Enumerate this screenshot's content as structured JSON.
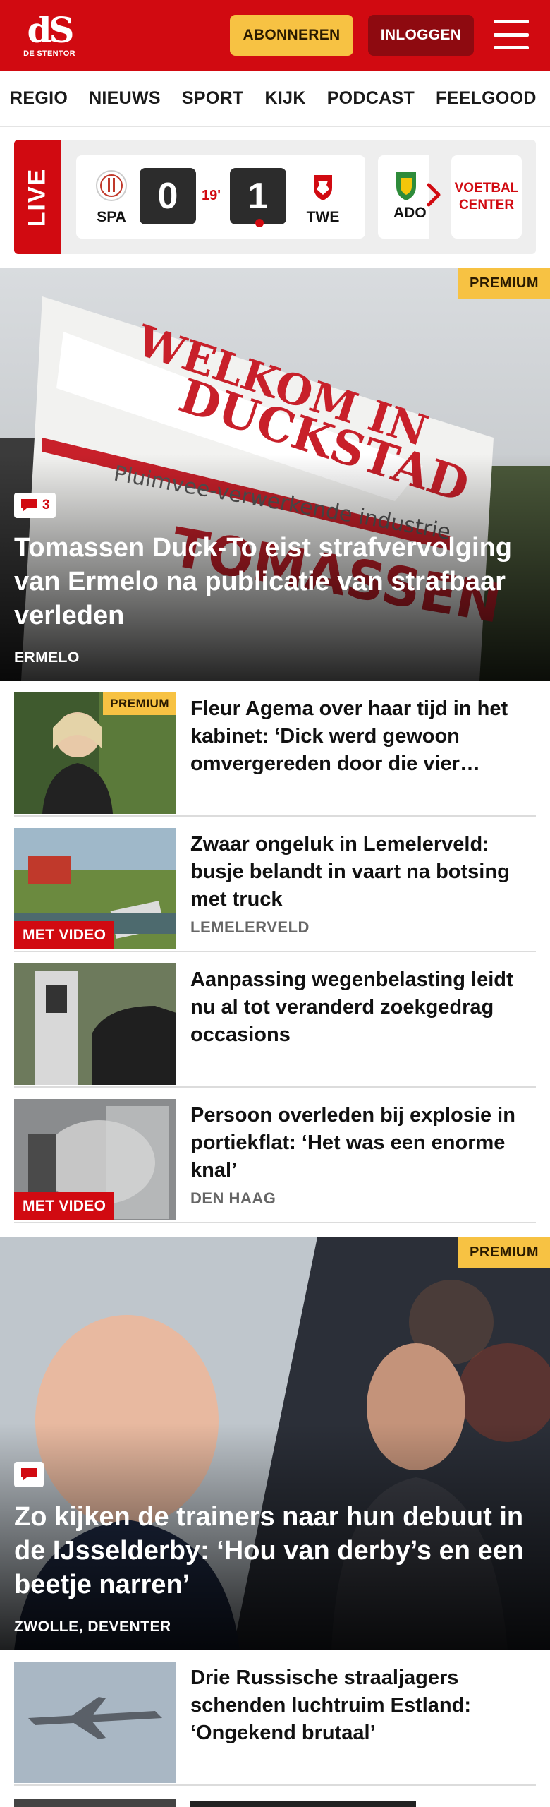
{
  "header": {
    "logo_mark": "dS",
    "logo_text": "DE STENTOR",
    "subscribe_label": "ABONNEREN",
    "login_label": "INLOGGEN"
  },
  "nav": {
    "items": [
      "REGIO",
      "NIEUWS",
      "SPORT",
      "KIJK",
      "PODCAST",
      "FEELGOOD"
    ]
  },
  "live": {
    "label": "LIVE",
    "match": {
      "home": "SPA",
      "home_score": "0",
      "minute": "19'",
      "away_score": "1",
      "away": "TWE"
    },
    "next_team": "ADO",
    "center_label": "VOETBAL CENTER"
  },
  "hero1": {
    "premium_label": "PREMIUM",
    "comment_count": "3",
    "title": "Tomassen Duck-To eist strafvervol­ging van Ermelo na publicatie van strafbaar verleden",
    "location": "ERMELO"
  },
  "articles1": [
    {
      "title": "Fleur Agema over haar tijd in het kabinet: ‘Dick werd gewoon omvergereden door die vier…",
      "badge": "PREMIUM",
      "location": ""
    },
    {
      "title": "Zwaar ongeluk in Lemelerveld: busje belandt in vaart na botsing met truck",
      "badge": "MET VIDEO",
      "location": "LEMELERVELD"
    },
    {
      "title": "Aanpassing wegenbelasting leidt nu al tot veranderd zoekgedrag occasions",
      "badge": "",
      "location": ""
    },
    {
      "title": "Persoon overleden bij explosie in portiekflat: ‘Het was een enorme knal’",
      "badge": "MET VIDEO",
      "location": "DEN HAAG"
    }
  ],
  "hero2": {
    "premium_label": "PREMIUM",
    "title": "Zo kijken de trainers naar hun debuut in de IJsselderby: ‘Hou van derby’s en een beetje narren’",
    "location": "ZWOLLE, DEVENTER"
  },
  "articles2": [
    {
      "title": "Drie Russische straaljagers schenden luchtruim Estland: ‘Ongekend brutaal’",
      "badge": "",
      "location": ""
    }
  ],
  "colors": {
    "brand_red": "#d10a11",
    "premium_yellow": "#f7c243",
    "login_dark_red": "#8e0a10"
  }
}
